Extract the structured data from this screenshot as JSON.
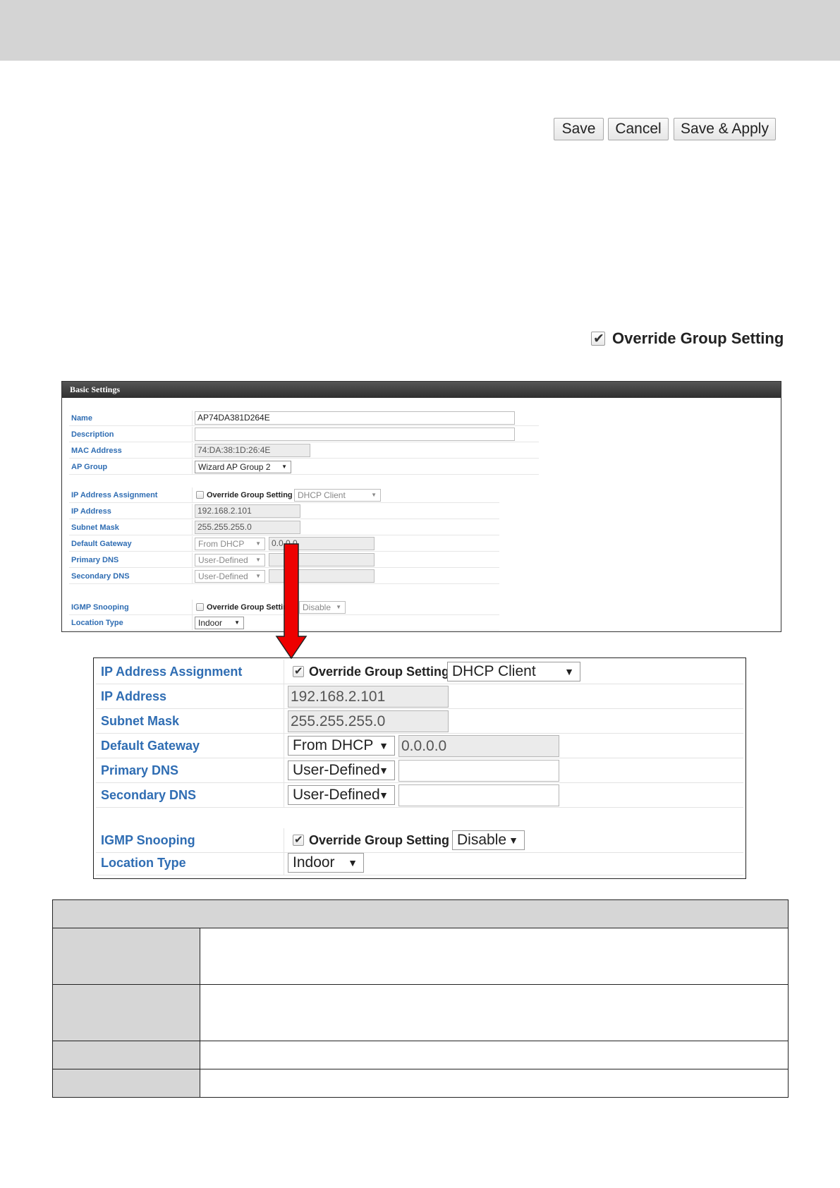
{
  "toolbar": {
    "save_label": "Save",
    "cancel_label": "Cancel",
    "save_apply_label": "Save & Apply"
  },
  "override_callout": {
    "checked": true,
    "label": "Override Group Setting"
  },
  "basic_settings": {
    "header": "Basic Settings",
    "name": {
      "label": "Name",
      "value": "AP74DA381D264E"
    },
    "description": {
      "label": "Description",
      "value": ""
    },
    "mac_address": {
      "label": "MAC Address",
      "value": "74:DA:38:1D:26:4E"
    },
    "ap_group": {
      "label": "AP Group",
      "value": "Wizard AP Group 2"
    },
    "ip_assignment": {
      "label": "IP Address Assignment",
      "override_label": "Override Group Setting",
      "checked": false,
      "value": "DHCP Client"
    },
    "ip_address": {
      "label": "IP Address",
      "value": "192.168.2.101"
    },
    "subnet_mask": {
      "label": "Subnet Mask",
      "value": "255.255.255.0"
    },
    "default_gateway": {
      "label": "Default Gateway",
      "mode": "From DHCP",
      "value": "0.0.0.0"
    },
    "primary_dns": {
      "label": "Primary DNS",
      "mode": "User-Defined",
      "value": ""
    },
    "secondary_dns": {
      "label": "Secondary DNS",
      "mode": "User-Defined",
      "value": ""
    },
    "igmp_snooping": {
      "label": "IGMP Snooping",
      "override_label": "Override Group Setting",
      "checked": false,
      "value": "Disable"
    },
    "location_type": {
      "label": "Location Type",
      "value": "Indoor"
    }
  },
  "zoom": {
    "ip_assignment": {
      "label": "IP Address Assignment",
      "override_label": "Override Group Setting",
      "checked": true,
      "value": "DHCP Client"
    },
    "ip_address": {
      "label": "IP Address",
      "value": "192.168.2.101"
    },
    "subnet_mask": {
      "label": "Subnet Mask",
      "value": "255.255.255.0"
    },
    "default_gateway": {
      "label": "Default Gateway",
      "mode": "From DHCP",
      "value": "0.0.0.0"
    },
    "primary_dns": {
      "label": "Primary DNS",
      "mode": "User-Defined",
      "value": ""
    },
    "secondary_dns": {
      "label": "Secondary DNS",
      "mode": "User-Defined",
      "value": ""
    },
    "igmp_snooping": {
      "label": "IGMP Snooping",
      "override_label": "Override Group Setting",
      "checked": true,
      "value": "Disable"
    },
    "location_type": {
      "label": "Location Type",
      "value": "Indoor"
    }
  },
  "colors": {
    "label_blue": "#2f6db3",
    "arrow_red": "#ee0000",
    "header_dark": "#333333",
    "band_gray": "#d4d4d4"
  }
}
